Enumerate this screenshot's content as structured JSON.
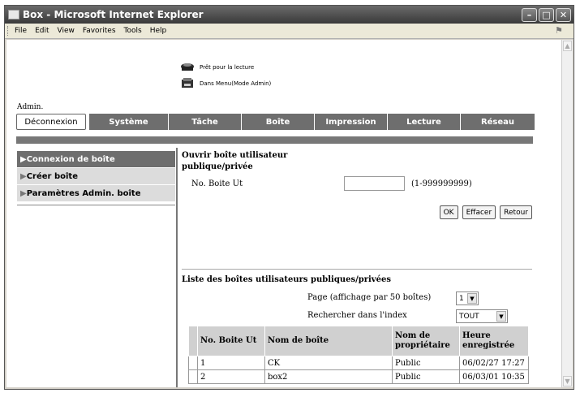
{
  "window": {
    "title": "Box - Microsoft Internet Explorer",
    "menu": [
      "File",
      "Edit",
      "View",
      "Favorites",
      "Tools",
      "Help"
    ]
  },
  "status": {
    "line1": "Prêt pour la lecture",
    "line2": "Dans Menu(Mode Admin)"
  },
  "admin_label": "Admin.",
  "tabs": {
    "logout": "Déconnexion",
    "items": [
      "Système",
      "Tâche",
      "Boîte",
      "Impression",
      "Lecture",
      "Réseau"
    ]
  },
  "sidebar": {
    "items": [
      "Connexion de boîte",
      "Créer boîte",
      "Paramètres Admin. boîte"
    ]
  },
  "open_box": {
    "title": "Ouvrir boîte utilisateur publique/privée",
    "field_label": "No. Boite Ut",
    "field_value": "",
    "range": "(1-999999999)",
    "ok": "OK",
    "clear": "Effacer",
    "back": "Retour"
  },
  "list": {
    "title": "Liste des boîtes utilisateurs publiques/privées",
    "page_label": "Page (affichage par 50 boîtes)",
    "page_value": "1",
    "index_label": "Rechercher dans l'index",
    "index_value": "TOUT",
    "headers": [
      "No. Boite Ut",
      "Nom de boîte",
      "Nom de propriétaire",
      "Heure enregistrée"
    ],
    "rows": [
      [
        "1",
        "CK",
        "Public",
        "06/02/27 17:27"
      ],
      [
        "2",
        "box2",
        "Public",
        "06/03/01 10:35"
      ]
    ]
  }
}
